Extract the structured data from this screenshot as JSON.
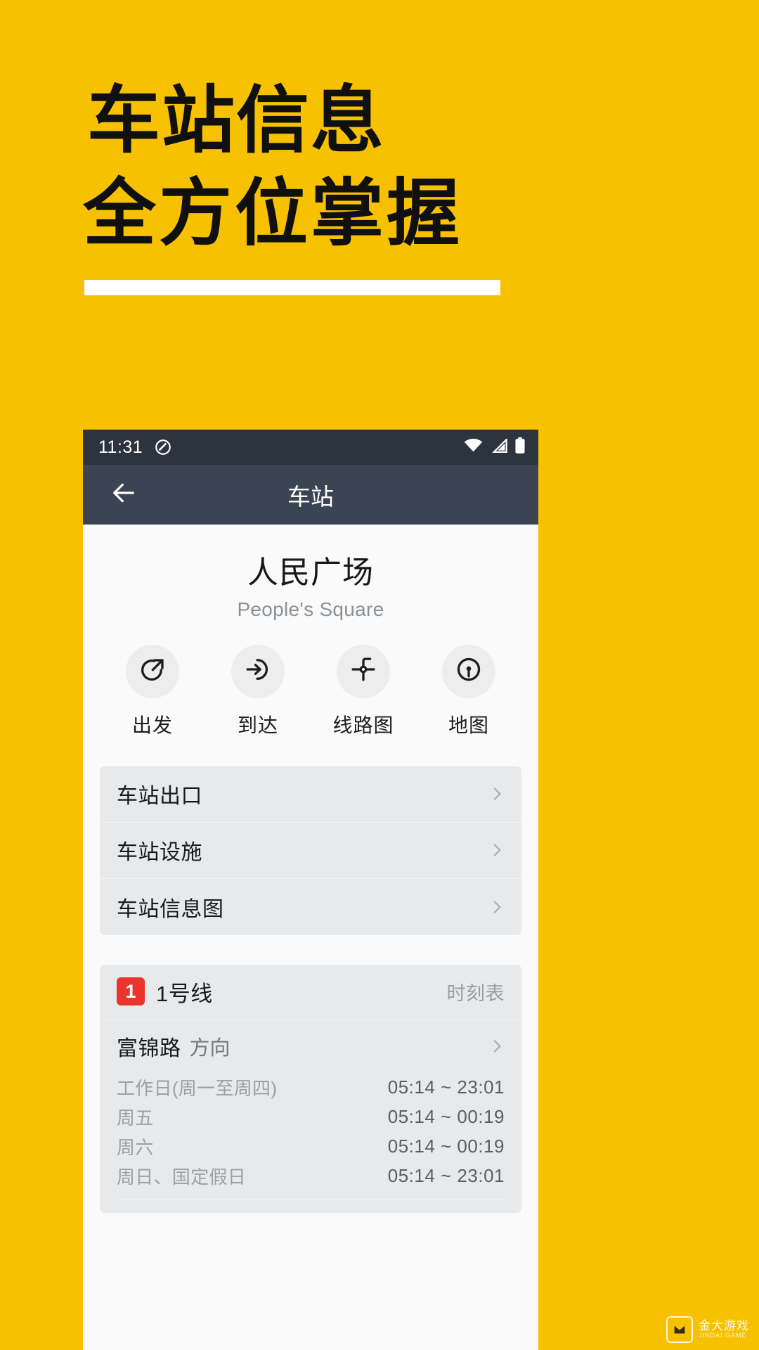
{
  "promo": {
    "line1": "车站信息",
    "line2": "全方位掌握"
  },
  "colors": {
    "background": "#F7C100",
    "appbar": "#3A4452",
    "statusbar": "#2C3440",
    "line_badge": "#E8362C",
    "card": "#E8E9EB"
  },
  "phone": {
    "statusbar": {
      "time": "11:31",
      "dnd_icon": "do-not-disturb-icon",
      "wifi_icon": "wifi-icon",
      "signal_icon": "cellular-signal-icon",
      "battery_icon": "battery-icon"
    },
    "appbar": {
      "back_icon": "back-arrow-icon",
      "title": "车站"
    },
    "station": {
      "name": "人民广场",
      "name_en": "People's Square"
    },
    "actions": [
      {
        "label": "出发",
        "icon": "departure-arrow-icon"
      },
      {
        "label": "到达",
        "icon": "arrival-arrow-icon"
      },
      {
        "label": "线路图",
        "icon": "route-map-icon"
      },
      {
        "label": "地图",
        "icon": "map-pin-icon"
      }
    ],
    "menu": [
      {
        "label": "车站出口",
        "chevron": "chevron-right-icon"
      },
      {
        "label": "车站设施",
        "chevron": "chevron-right-icon"
      },
      {
        "label": "车站信息图",
        "chevron": "chevron-right-icon"
      }
    ],
    "line_section": {
      "badge": "1",
      "name": "1号线",
      "timetable_label": "时刻表",
      "direction": {
        "name": "富锦路",
        "suffix": "方向",
        "chevron": "chevron-right-icon"
      },
      "schedule": [
        {
          "day": "工作日(周一至周四)",
          "time": "05:14 ~ 23:01"
        },
        {
          "day": "周五",
          "time": "05:14 ~ 00:19"
        },
        {
          "day": "周六",
          "time": "05:14 ~ 00:19"
        },
        {
          "day": "周日、国定假日",
          "time": "05:14 ~ 23:01"
        }
      ]
    }
  },
  "watermark": {
    "title": "金大游戏",
    "subtitle": "JINDAI GAME"
  }
}
